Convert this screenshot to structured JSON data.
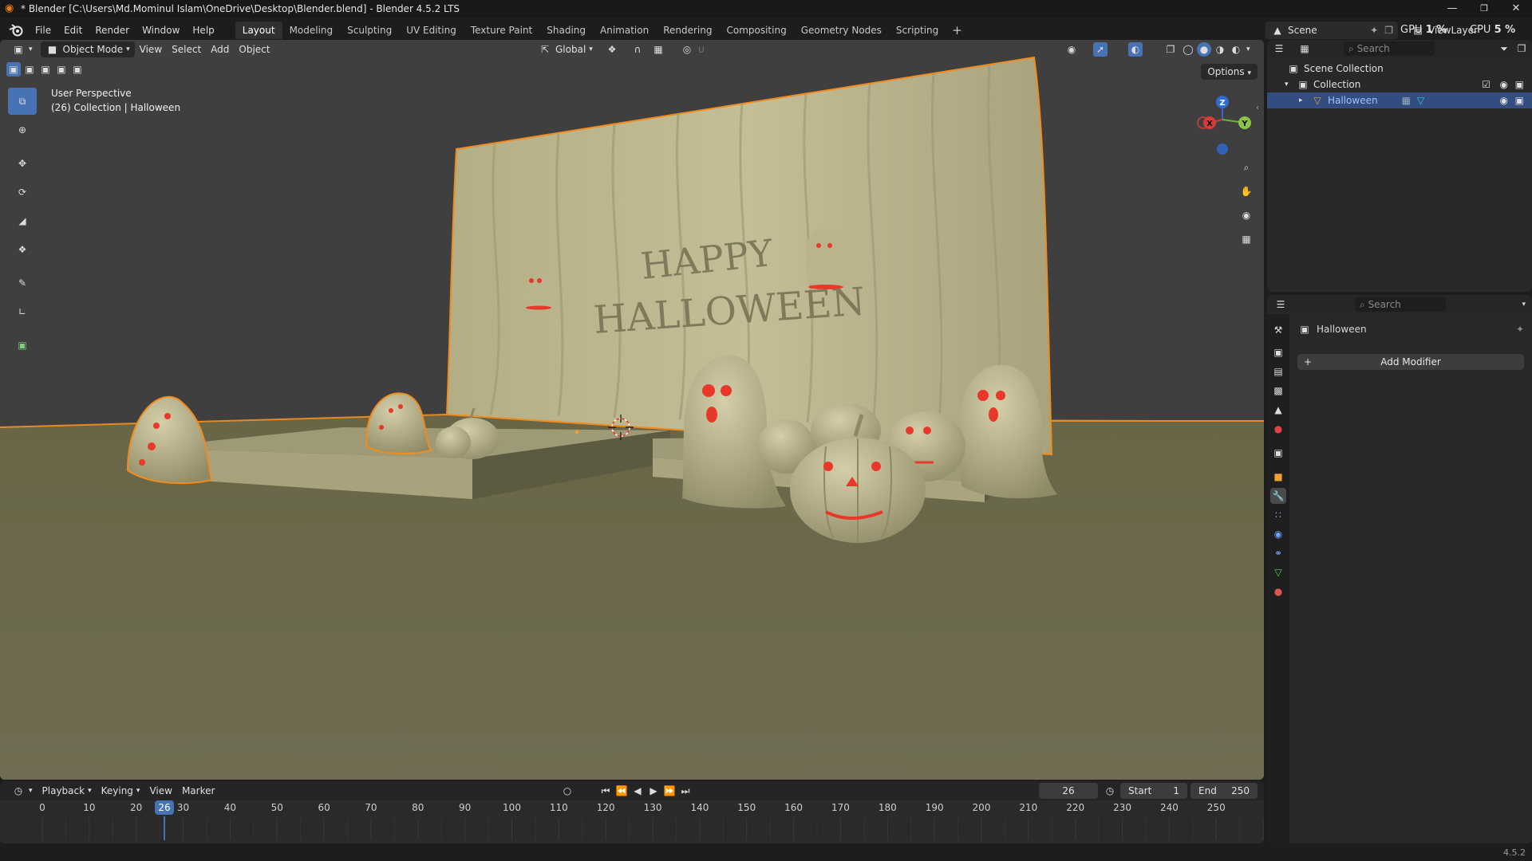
{
  "window": {
    "title": "* Blender [C:\\Users\\Md.Mominul Islam\\OneDrive\\Desktop\\Blender.blend] - Blender 4.5.2 LTS",
    "minimize": "—",
    "maximize": "❐",
    "close": "✕"
  },
  "menus": [
    "File",
    "Edit",
    "Render",
    "Window",
    "Help"
  ],
  "workspaces": [
    "Layout",
    "Modeling",
    "Sculpting",
    "UV Editing",
    "Texture Paint",
    "Shading",
    "Animation",
    "Rendering",
    "Compositing",
    "Geometry Nodes",
    "Scripting"
  ],
  "active_workspace": "Layout",
  "scene": {
    "name": "Scene",
    "view_layer": "ViewLayer"
  },
  "resources": {
    "gpu_label": "GPU",
    "gpu_value": "1 %",
    "cpu_label": "CPU",
    "cpu_value": "5 %"
  },
  "viewport": {
    "mode": "Object Mode",
    "menus": [
      "View",
      "Select",
      "Add",
      "Object"
    ],
    "orientation": "Global",
    "options": "Options",
    "overlay_title": "User Perspective",
    "overlay_subtitle": "(26) Collection | Halloween",
    "gizmo_axes": {
      "z": "Z",
      "x": "X",
      "y": "Y"
    },
    "scene_text_line1": "HAPPY",
    "scene_text_line2": "HALLOWEEN"
  },
  "timeline": {
    "menus": [
      "Playback",
      "Keying",
      "View",
      "Marker"
    ],
    "current_frame": "26",
    "start_label": "Start",
    "start_value": "1",
    "end_label": "End",
    "end_value": "250",
    "ticks": [
      "0",
      "10",
      "20",
      "30",
      "40",
      "50",
      "60",
      "70",
      "80",
      "90",
      "100",
      "110",
      "120",
      "130",
      "140",
      "150",
      "160",
      "170",
      "180",
      "190",
      "200",
      "210",
      "220",
      "230",
      "240",
      "250"
    ],
    "playhead_label": "26"
  },
  "outliner": {
    "search_placeholder": "Search",
    "scene_collection": "Scene Collection",
    "collection": "Collection",
    "object": "Halloween"
  },
  "properties": {
    "search_placeholder": "Search",
    "object_name": "Halloween",
    "add_modifier": "Add Modifier"
  },
  "status": {
    "version": "4.5.2"
  },
  "colors": {
    "accent": "#4772b3",
    "selection_outline": "#f08c1e",
    "ground": "#6d6a4e",
    "clay": "#bcb791",
    "face_red": "#e8382a"
  }
}
